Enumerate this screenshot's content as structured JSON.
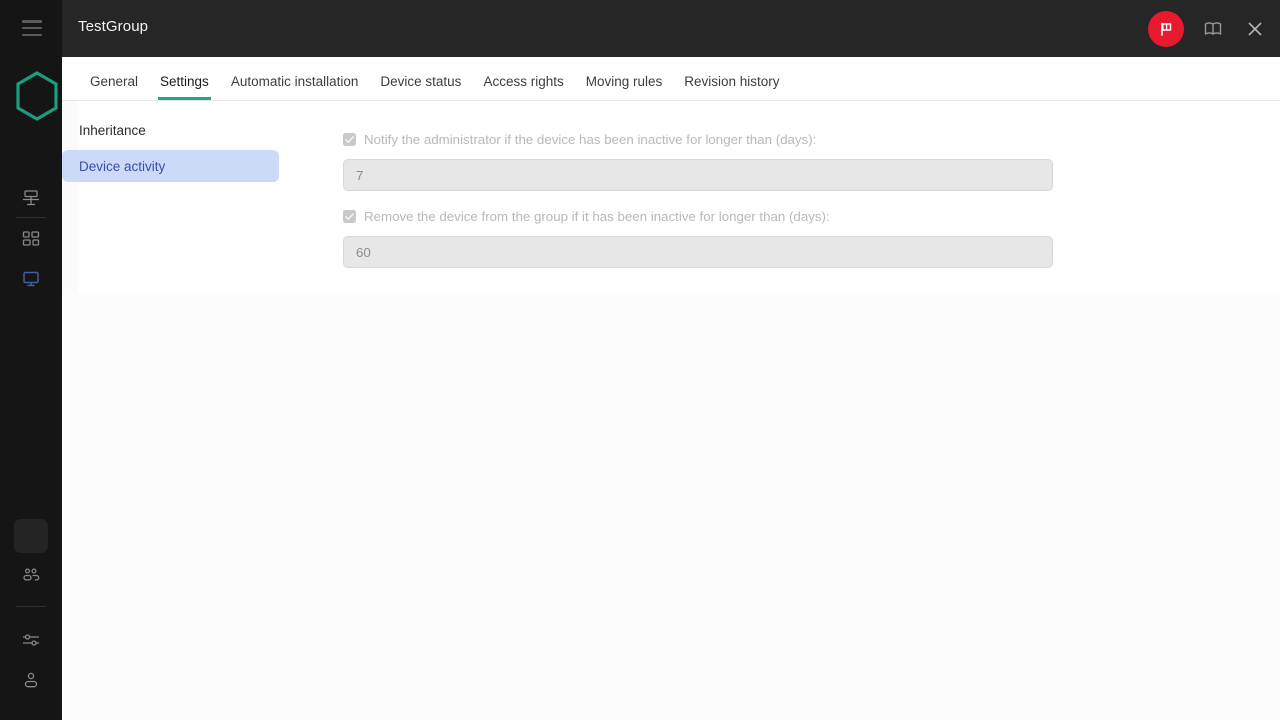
{
  "window": {
    "title": "TestGroup"
  },
  "rail": {
    "hamburger_name": "hamburger-menu-icon",
    "logo_name": "kaspersky-hexagon-logo",
    "items": [
      {
        "name": "server-icon",
        "label": "Server"
      },
      {
        "name": "dashboard-grid-icon",
        "label": "Dashboard"
      },
      {
        "name": "monitor-devices-icon",
        "label": "Devices",
        "active": true
      },
      {
        "name": "users-group-icon",
        "label": "Users"
      },
      {
        "name": "sliders-settings-icon",
        "label": "Settings"
      },
      {
        "name": "user-account-icon",
        "label": "Account"
      }
    ]
  },
  "header": {
    "flag_badge_label": "flag-icon",
    "manual_label": "book-manual-icon",
    "close_label": "close-icon",
    "accent_red": "#e8192c"
  },
  "tabs": [
    {
      "label": "General",
      "active": false
    },
    {
      "label": "Settings",
      "active": true
    },
    {
      "label": "Automatic installation",
      "active": false
    },
    {
      "label": "Device status",
      "active": false
    },
    {
      "label": "Access rights",
      "active": false
    },
    {
      "label": "Moving rules",
      "active": false
    },
    {
      "label": "Revision history",
      "active": false
    }
  ],
  "subnav": {
    "items": [
      {
        "label": "Inheritance",
        "active": false
      },
      {
        "label": "Device activity",
        "active": true
      }
    ]
  },
  "form": {
    "notify": {
      "label": "Notify the administrator if the device has been inactive for longer than (days):",
      "checked": true,
      "disabled": true,
      "value": "7",
      "placeholder": "7"
    },
    "remove": {
      "label": "Remove the device from the group if it has been inactive for longer than (days):",
      "checked": true,
      "disabled": true,
      "value": "60",
      "placeholder": "60"
    }
  },
  "colors": {
    "accent_teal": "#23a387",
    "selected_bg": "#ccd9f7",
    "selected_text": "#3a4bb0",
    "rail_bg": "#151515",
    "topbar_bg": "#262626"
  }
}
